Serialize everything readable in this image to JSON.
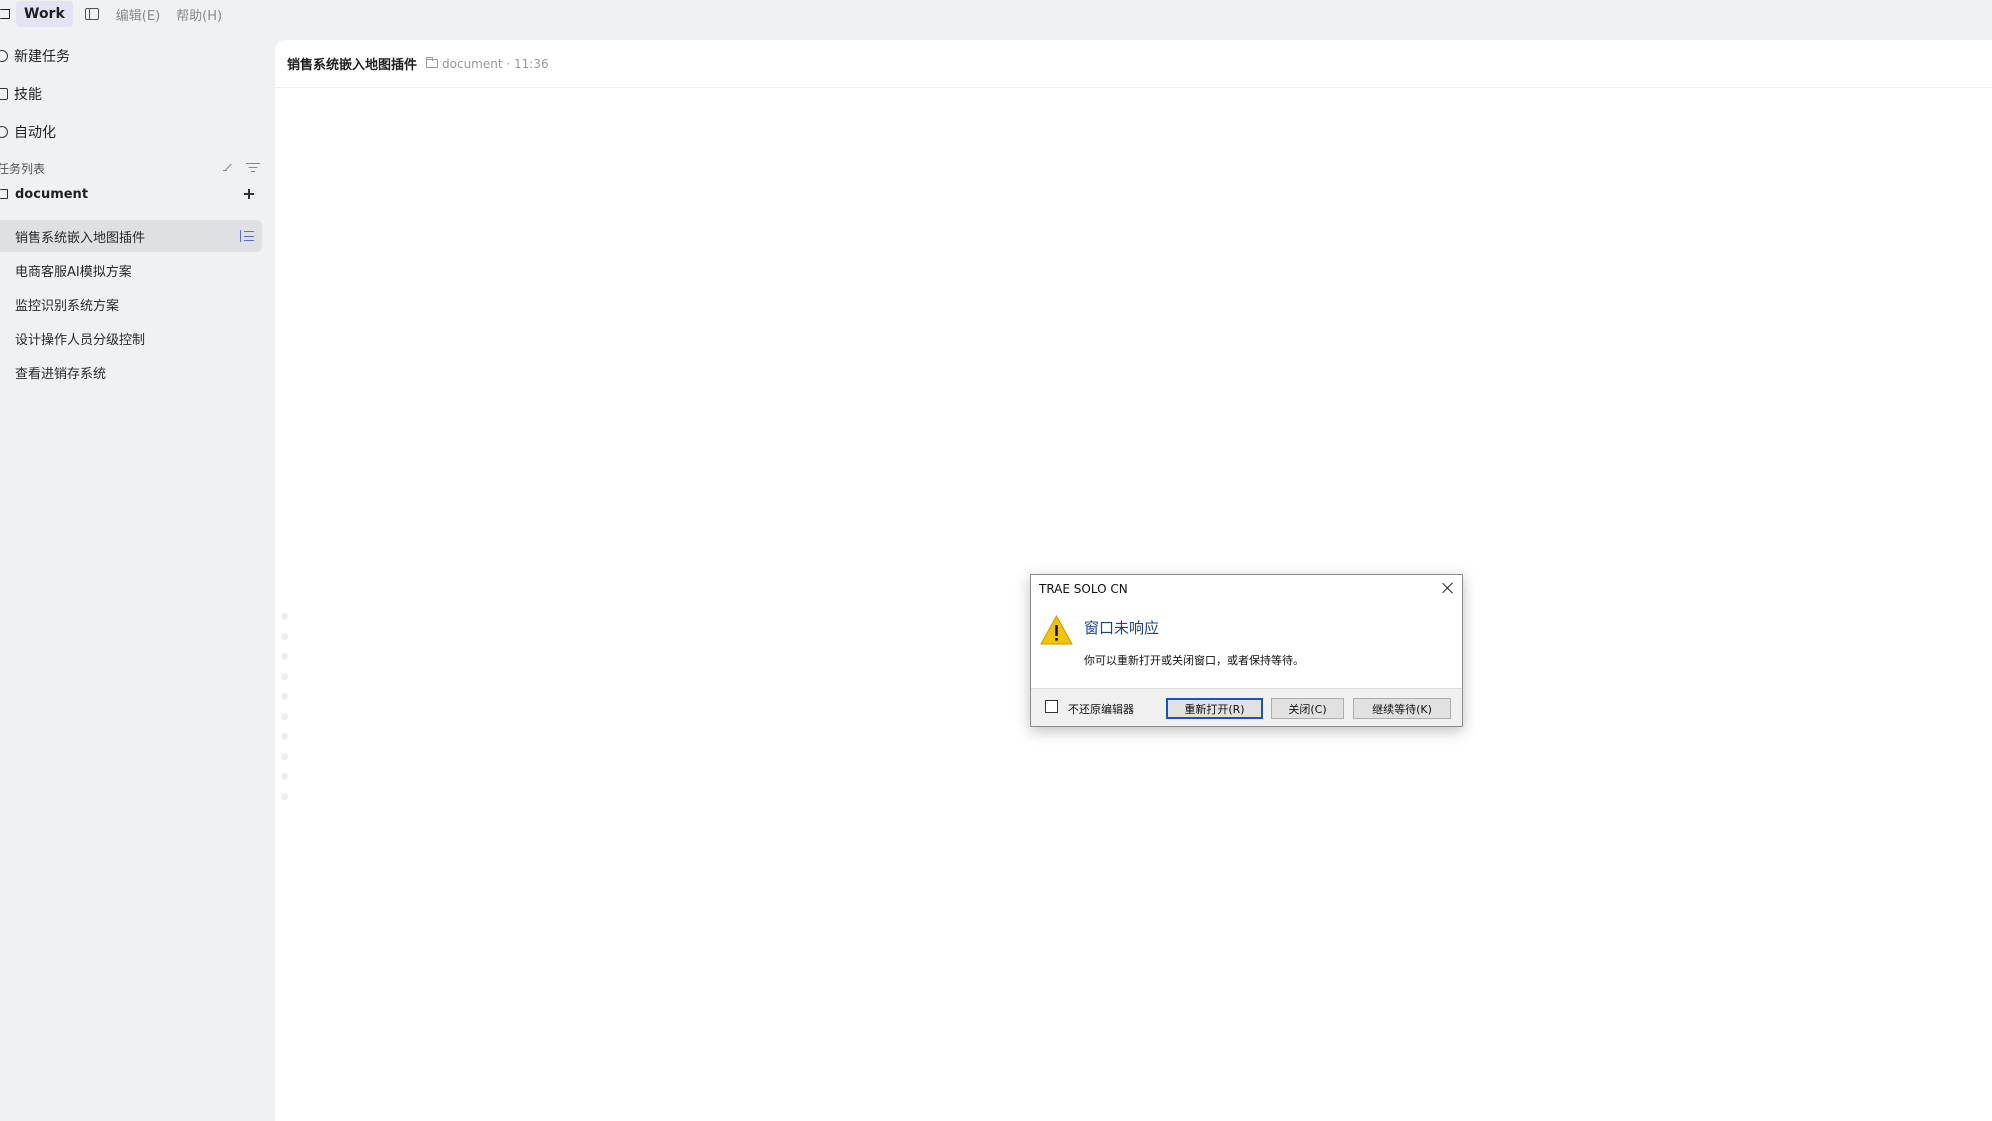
{
  "menubar": {
    "app_tab": "Work",
    "menus": [
      "编辑(E)",
      "帮助(H)"
    ]
  },
  "sidebar": {
    "nav": [
      {
        "label": "新建任务",
        "icon": "plus-circle-icon"
      },
      {
        "label": "技能",
        "icon": "skill-icon"
      },
      {
        "label": "自动化",
        "icon": "clock-icon"
      }
    ],
    "section_title": "任务列表",
    "folder": "document",
    "tasks": [
      {
        "label": "销售系统嵌入地图插件",
        "active": true
      },
      {
        "label": "电商客服AI模拟方案",
        "active": false
      },
      {
        "label": "监控识别系统方案",
        "active": false
      },
      {
        "label": "设计操作人员分级控制",
        "active": false
      },
      {
        "label": "查看进销存系统",
        "active": false
      }
    ]
  },
  "main": {
    "title": "销售系统嵌入地图插件",
    "meta": "document · 11:36"
  },
  "dialog": {
    "title": "TRAE SOLO CN",
    "heading": "窗口未响应",
    "message": "你可以重新打开或关闭窗口，或者保持等待。",
    "checkbox_label": "不还原编辑器",
    "buttons": {
      "reopen": "重新打开(R)",
      "close": "关闭(C)",
      "wait": "继续等待(K)"
    }
  },
  "colors": {
    "background": "#f0f1f3",
    "active_tab": "#e2e3f3",
    "accent": "#5a6be0",
    "dialog_heading": "#1a3ea8",
    "warning": "#f5c400"
  }
}
